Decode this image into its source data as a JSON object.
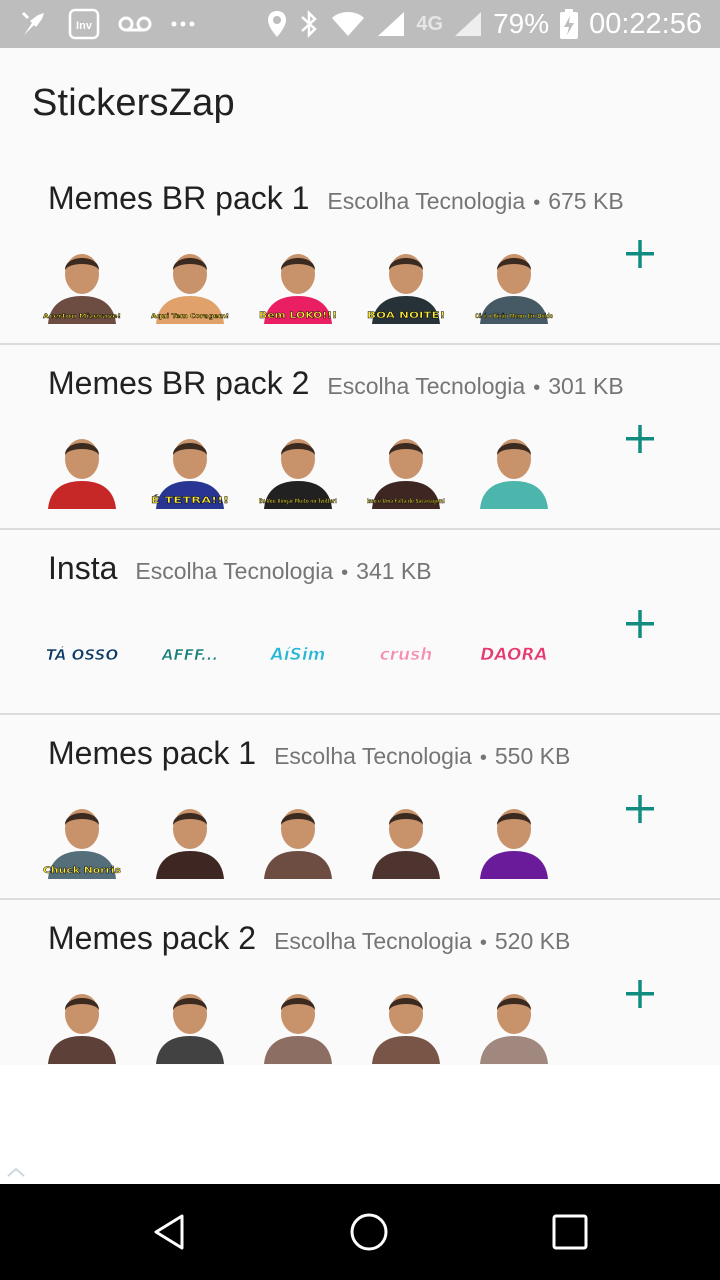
{
  "status_bar": {
    "battery": "79%",
    "time": "00:22:56",
    "network": "4G",
    "icons": [
      "notification-icon",
      "inv-app-icon",
      "voicemail-icon",
      "more-dots-icon",
      "location-icon",
      "bluetooth-icon",
      "wifi-icon",
      "signal-icon",
      "battery-charging-icon"
    ]
  },
  "app": {
    "title": "StickersZap"
  },
  "packs": [
    {
      "name": "Memes BR pack 1",
      "publisher": "Escolha Tecnologia",
      "separator": "•",
      "size": "675 KB",
      "stickers": [
        {
          "caption": "Acertou Mizerave!",
          "color": "#6d4c41"
        },
        {
          "caption": "Aqui Tem Coragem!",
          "color": "#e0a16b"
        },
        {
          "caption": "Bem LOKO!!!",
          "color": "#e91e63"
        },
        {
          "caption": "BOA NOITE!",
          "color": "#263238"
        },
        {
          "caption": "Cê é o Bixão Memo Em Doido",
          "color": "#455a64"
        }
      ]
    },
    {
      "name": "Memes BR pack 2",
      "publisher": "Escolha Tecnologia",
      "separator": "•",
      "size": "301 KB",
      "stickers": [
        {
          "caption": "",
          "color": "#c62828"
        },
        {
          "caption": "É TETRA!!!",
          "color": "#283593"
        },
        {
          "caption": "Eu Vou Xingar Muito no Twitter!",
          "color": "#212121"
        },
        {
          "caption": "Isso é Uma Falta de Sacanagem!",
          "color": "#3e2723"
        },
        {
          "caption": "",
          "color": "#4db6ac"
        }
      ]
    },
    {
      "name": "Insta",
      "publisher": "Escolha Tecnologia",
      "separator": "•",
      "size": "341 KB",
      "stickers": [
        {
          "caption": "TÁ OSSO",
          "color": "#0d3b66"
        },
        {
          "caption": "AFFF...",
          "color": "#1b7f7a"
        },
        {
          "caption": "AíSim",
          "color": "#29b6d4"
        },
        {
          "caption": "crush",
          "color": "#f48fb1"
        },
        {
          "caption": "DAORA",
          "color": "#e53970"
        }
      ]
    },
    {
      "name": "Memes pack 1",
      "publisher": "Escolha Tecnologia",
      "separator": "•",
      "size": "550 KB",
      "stickers": [
        {
          "caption": "Chuck Norris",
          "color": "#546e7a"
        },
        {
          "caption": "",
          "color": "#3e2723"
        },
        {
          "caption": "",
          "color": "#6d4c41"
        },
        {
          "caption": "",
          "color": "#4e342e"
        },
        {
          "caption": "",
          "color": "#6a1b9a"
        }
      ]
    },
    {
      "name": "Memes pack 2",
      "publisher": "Escolha Tecnologia",
      "separator": "•",
      "size": "520 KB",
      "stickers": [
        {
          "caption": "",
          "color": "#5d4037"
        },
        {
          "caption": "",
          "color": "#424242"
        },
        {
          "caption": "",
          "color": "#8d6e63"
        },
        {
          "caption": "",
          "color": "#795548"
        },
        {
          "caption": "",
          "color": "#a1887f"
        }
      ]
    }
  ],
  "theme": {
    "accent": "#128c7e",
    "status_bar": "#bdbdbd",
    "text_primary": "#212121",
    "text_secondary": "#757575"
  },
  "nav": {
    "icons": [
      "back-icon",
      "home-icon",
      "recents-icon"
    ]
  }
}
